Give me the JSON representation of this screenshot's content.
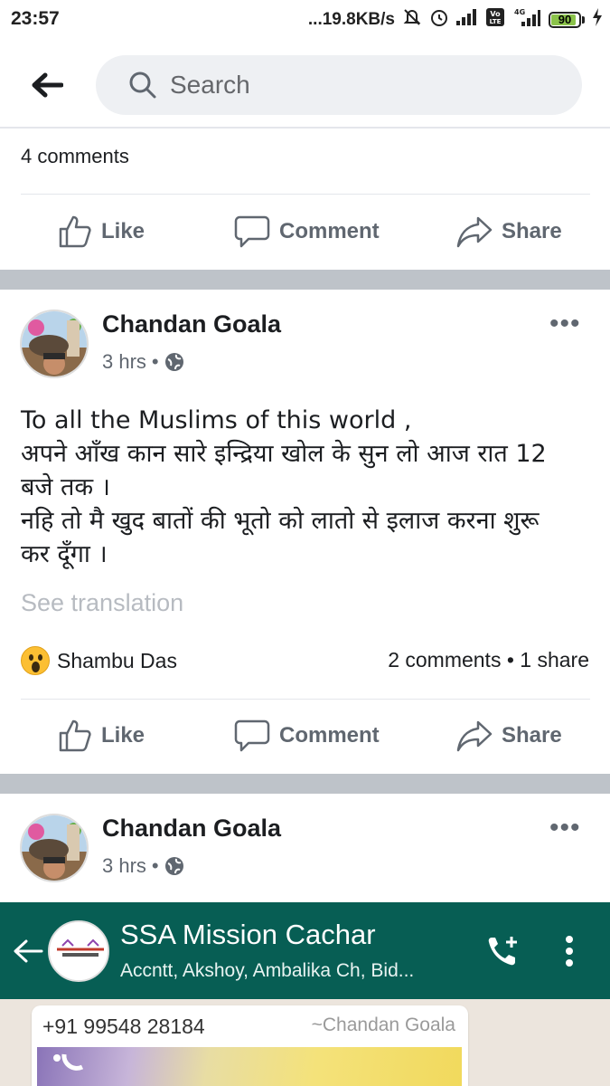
{
  "status_bar": {
    "time": "23:57",
    "network_speed": "...19.8KB/s",
    "battery": "90",
    "network_type": "4G"
  },
  "search": {
    "placeholder": "Search",
    "back_icon": "back-arrow-icon",
    "search_icon": "search-icon"
  },
  "prev_post": {
    "comments_count": "4 comments"
  },
  "actions": {
    "like": "Like",
    "comment": "Comment",
    "share": "Share"
  },
  "post1": {
    "author": "Chandan Goala",
    "time": "3 hrs",
    "privacy_icon": "globe-icon",
    "text_lines": [
      "To all the Muslims of this world ,",
      "अपने आँख कान सारे इन्द्रिया खोल के सुन लो आज रात 12",
      "बजे तक ।",
      "नहि तो मै खुद बातों की भूतो को लातो से इलाज करना शुरू",
      "कर दूँगा ।"
    ],
    "see_translation": "See translation",
    "reactor": "Shambu Das",
    "reaction_icon": "wow-reaction-icon",
    "counts": "2 comments • 1 share"
  },
  "post2": {
    "author": "Chandan Goala",
    "time": "3 hrs",
    "privacy_icon": "globe-icon"
  },
  "shared_image": {
    "group_title": "SSA Mission Cachar",
    "members": "Accntt, Akshoy, Ambalika Ch, Bid...",
    "message_phone": "+91 99548 28184",
    "message_sender": "~Chandan Goala",
    "header_color": "#075e54"
  },
  "colors": {
    "brand_text": "#1c1e21",
    "secondary_text": "#606770",
    "separator": "#bec3c9"
  }
}
